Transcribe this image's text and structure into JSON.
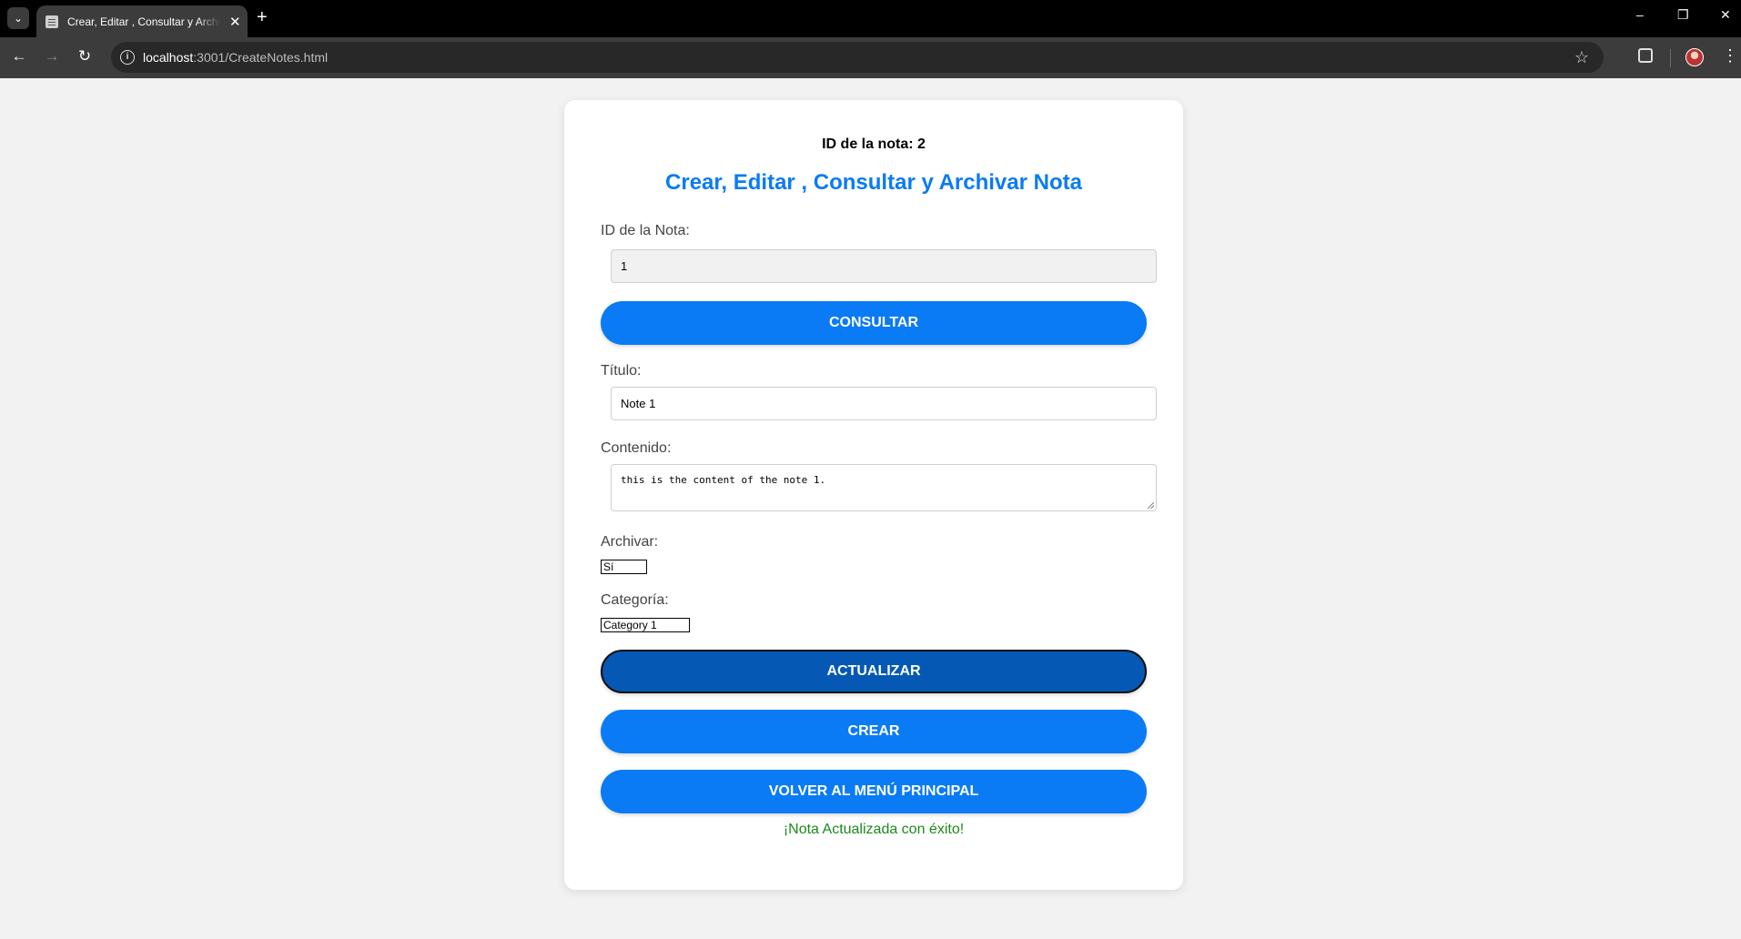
{
  "browser": {
    "tab_title": "Crear, Editar , Consultar y Archivar Nota",
    "url_host": "localhost",
    "url_rest": ":3001/CreateNotes.html",
    "icons": {
      "tab_list": "chevron-down-icon",
      "favicon": "notepad-icon",
      "close": "close-icon",
      "new_tab": "plus-icon",
      "back": "arrow-left-icon",
      "forward": "arrow-right-icon",
      "reload": "reload-icon",
      "site_info": "info-icon",
      "bookmark": "star-icon",
      "extensions": "puzzle-icon",
      "profile": "avatar",
      "menu": "kebab-menu-icon"
    }
  },
  "page": {
    "note_id_heading": "ID de la nota: 2",
    "title": "Crear, Editar , Consultar y Archivar Nota",
    "id_label": "ID de la Nota:",
    "id_value": "1",
    "consult_button": "CONSULTAR",
    "title_label": "Título:",
    "title_value": "Note 1",
    "content_label": "Contenido:",
    "content_value": "this is the content of the note 1.",
    "archive_label": "Archivar:",
    "archive_value": "Sí",
    "category_label": "Categoría:",
    "category_value": "Category 1",
    "update_button": "ACTUALIZAR",
    "create_button": "CREAR",
    "back_button": "VOLVER AL MENÚ PRINCIPAL",
    "status_message": "¡Nota Actualizada con éxito!"
  },
  "colors": {
    "accent": "#0a7bf5",
    "accent_active": "#0559b5",
    "success": "#1a8a1a",
    "page_bg": "#f2f2f2"
  }
}
